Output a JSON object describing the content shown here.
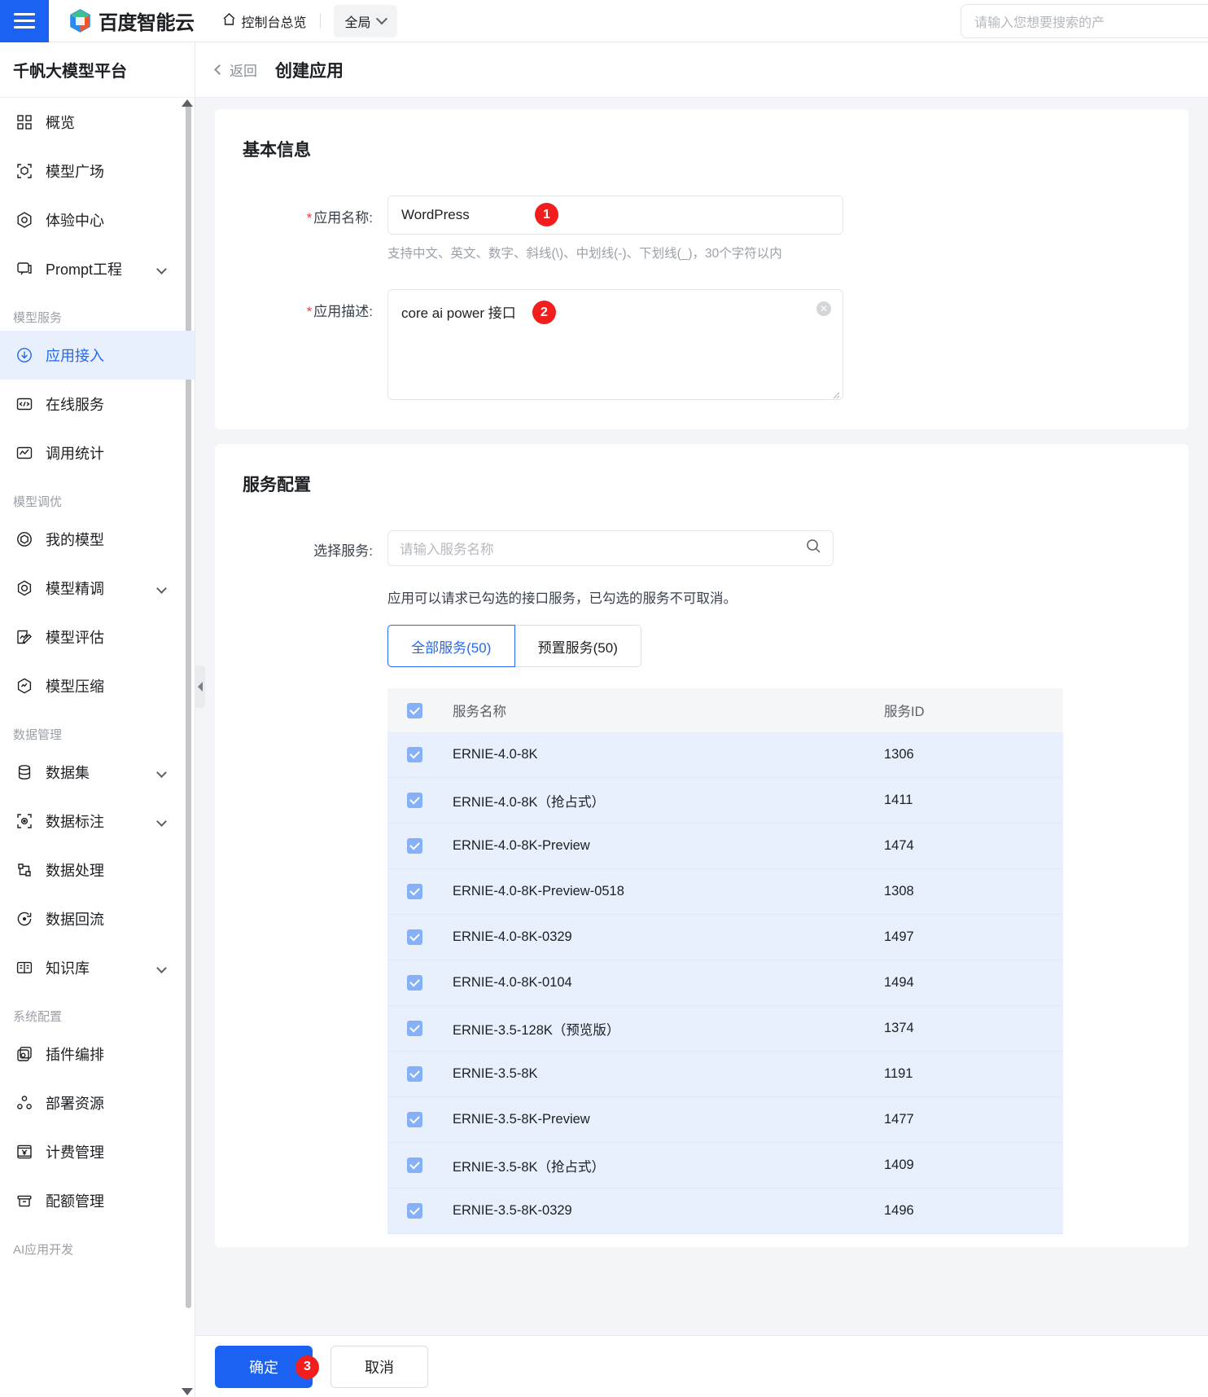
{
  "topbar": {
    "menu_icon": "hamburger-icon",
    "brand_name": "百度智能云",
    "console_label": "控制台总览",
    "home_icon": "home-icon",
    "scope_label": "全局",
    "scope_caret": "chevron-down-icon",
    "search_placeholder": "请输入您想要搜索的产"
  },
  "sidebar": {
    "title": "千帆大模型平台",
    "items": [
      {
        "label": "概览",
        "icon": "grid-icon",
        "type": "item",
        "active": false,
        "caret": false
      },
      {
        "label": "模型广场",
        "icon": "cube-scan-icon",
        "type": "item",
        "active": false,
        "caret": false
      },
      {
        "label": "体验中心",
        "icon": "hexagon-icon",
        "type": "item",
        "active": false,
        "caret": false
      },
      {
        "label": "Prompt工程",
        "icon": "chat-icon",
        "type": "item",
        "active": false,
        "caret": true
      },
      {
        "label": "模型服务",
        "icon": "",
        "type": "group",
        "active": false,
        "caret": false
      },
      {
        "label": "应用接入",
        "icon": "download-icon",
        "type": "item",
        "active": true,
        "caret": false
      },
      {
        "label": "在线服务",
        "icon": "code-icon",
        "type": "item",
        "active": false,
        "caret": false
      },
      {
        "label": "调用统计",
        "icon": "chart-icon",
        "type": "item",
        "active": false,
        "caret": false
      },
      {
        "label": "模型调优",
        "icon": "",
        "type": "group",
        "active": false,
        "caret": false
      },
      {
        "label": "我的模型",
        "icon": "circle-cube-icon",
        "type": "item",
        "active": false,
        "caret": false
      },
      {
        "label": "模型精调",
        "icon": "hex-check-icon",
        "type": "item",
        "active": false,
        "caret": true
      },
      {
        "label": "模型评估",
        "icon": "edit-chart-icon",
        "type": "item",
        "active": false,
        "caret": false
      },
      {
        "label": "模型压缩",
        "icon": "hex-chart-icon",
        "type": "item",
        "active": false,
        "caret": false
      },
      {
        "label": "数据管理",
        "icon": "",
        "type": "group",
        "active": false,
        "caret": false
      },
      {
        "label": "数据集",
        "icon": "database-icon",
        "type": "item",
        "active": false,
        "caret": true
      },
      {
        "label": "数据标注",
        "icon": "target-scan-icon",
        "type": "item",
        "active": false,
        "caret": true
      },
      {
        "label": "数据处理",
        "icon": "crop-icon",
        "type": "item",
        "active": false,
        "caret": false
      },
      {
        "label": "数据回流",
        "icon": "refresh-icon",
        "type": "item",
        "active": false,
        "caret": false
      },
      {
        "label": "知识库",
        "icon": "book-icon",
        "type": "item",
        "active": false,
        "caret": true
      },
      {
        "label": "系统配置",
        "icon": "",
        "type": "group",
        "active": false,
        "caret": false
      },
      {
        "label": "插件编排",
        "icon": "plugin-icon",
        "type": "item",
        "active": false,
        "caret": false
      },
      {
        "label": "部署资源",
        "icon": "nodes-icon",
        "type": "item",
        "active": false,
        "caret": false
      },
      {
        "label": "计费管理",
        "icon": "yuan-icon",
        "type": "item",
        "active": false,
        "caret": false
      },
      {
        "label": "配额管理",
        "icon": "box-icon",
        "type": "item",
        "active": false,
        "caret": false
      },
      {
        "label": "AI应用开发",
        "icon": "",
        "type": "group",
        "active": false,
        "caret": false
      }
    ]
  },
  "page": {
    "back_label": "返回",
    "title": "创建应用"
  },
  "basic_info": {
    "card_title": "基本信息",
    "name_label": "应用名称:",
    "name_value": "WordPress",
    "name_hint": "支持中文、英文、数字、斜线(\\)、中划线(-)、下划线(_)，30个字符以内",
    "desc_label": "应用描述:",
    "desc_value": "core ai power 接口",
    "desc_clear_icon": "clear-circle-icon"
  },
  "service_config": {
    "card_title": "服务配置",
    "select_label": "选择服务:",
    "search_placeholder": "请输入服务名称",
    "search_icon": "search-icon",
    "note": "应用可以请求已勾选的接口服务，已勾选的服务不可取消。",
    "tabs": [
      {
        "label": "全部服务(50)",
        "active": true
      },
      {
        "label": "预置服务(50)",
        "active": false
      }
    ],
    "table": {
      "columns": [
        "服务名称",
        "服务ID"
      ],
      "header_checked": true,
      "rows": [
        {
          "name": "ERNIE-4.0-8K",
          "id": "1306",
          "checked": true
        },
        {
          "name": "ERNIE-4.0-8K（抢占式）",
          "id": "1411",
          "checked": true
        },
        {
          "name": "ERNIE-4.0-8K-Preview",
          "id": "1474",
          "checked": true
        },
        {
          "name": "ERNIE-4.0-8K-Preview-0518",
          "id": "1308",
          "checked": true
        },
        {
          "name": "ERNIE-4.0-8K-0329",
          "id": "1497",
          "checked": true
        },
        {
          "name": "ERNIE-4.0-8K-0104",
          "id": "1494",
          "checked": true
        },
        {
          "name": "ERNIE-3.5-128K（预览版）",
          "id": "1374",
          "checked": true
        },
        {
          "name": "ERNIE-3.5-8K",
          "id": "1191",
          "checked": true
        },
        {
          "name": "ERNIE-3.5-8K-Preview",
          "id": "1477",
          "checked": true
        },
        {
          "name": "ERNIE-3.5-8K（抢占式）",
          "id": "1409",
          "checked": true
        },
        {
          "name": "ERNIE-3.5-8K-0329",
          "id": "1496",
          "checked": true
        }
      ]
    }
  },
  "actions": {
    "confirm_label": "确定",
    "cancel_label": "取消"
  },
  "step_badges": [
    {
      "n": "1"
    },
    {
      "n": "2"
    },
    {
      "n": "3"
    }
  ],
  "colors": {
    "brand_blue": "#1b62f2",
    "link_blue": "#2468f2",
    "badge_red": "#f21d1d",
    "row_selected": "#e8f0fd"
  }
}
